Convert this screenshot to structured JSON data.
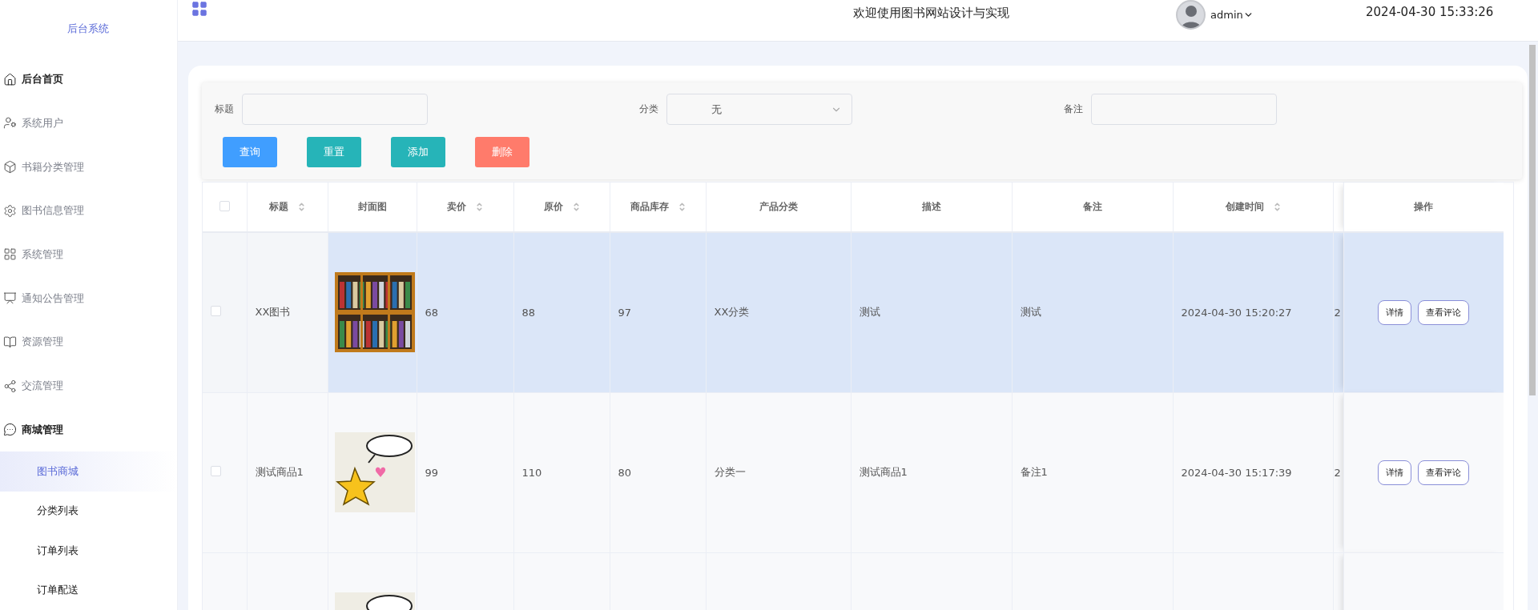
{
  "sidebar": {
    "title": "后台系统",
    "items": [
      {
        "label": "后台首页",
        "hovered": true,
        "expanded": false
      },
      {
        "label": "系统用户",
        "hovered": false,
        "expanded": false
      },
      {
        "label": "书籍分类管理",
        "hovered": false,
        "expanded": false
      },
      {
        "label": "图书信息管理",
        "hovered": false,
        "expanded": false
      },
      {
        "label": "系统管理",
        "hovered": false,
        "expanded": false
      },
      {
        "label": "通知公告管理",
        "hovered": false,
        "expanded": false
      },
      {
        "label": "资源管理",
        "hovered": false,
        "expanded": false
      },
      {
        "label": "交流管理",
        "hovered": false,
        "expanded": false
      },
      {
        "label": "商城管理",
        "hovered": false,
        "expanded": true,
        "children": [
          {
            "label": "图书商城",
            "selected": true
          },
          {
            "label": "分类列表",
            "selected": false
          },
          {
            "label": "订单列表",
            "selected": false
          },
          {
            "label": "订单配送",
            "selected": false
          }
        ]
      }
    ]
  },
  "header": {
    "title": "欢迎使用图书网站设计与实现",
    "user": "admin",
    "datetime": "2024-04-30 15:33:26"
  },
  "filters": [
    {
      "label": "标题",
      "kind": "input"
    },
    {
      "label": "分类",
      "kind": "select",
      "value": "无"
    },
    {
      "label": "备注",
      "kind": "input"
    }
  ],
  "buttons": [
    {
      "label": "查询",
      "kind": "primary"
    },
    {
      "label": "重置",
      "kind": "teal"
    },
    {
      "label": "添加",
      "kind": "teal"
    },
    {
      "label": "删除",
      "kind": "danger"
    }
  ],
  "table": {
    "all_checked": false,
    "columns": [
      {
        "label": "标题",
        "sortable": true
      },
      {
        "label": "封面图",
        "sortable": false
      },
      {
        "label": "卖价",
        "sortable": true
      },
      {
        "label": "原价",
        "sortable": true
      },
      {
        "label": "商品库存",
        "sortable": true
      },
      {
        "label": "产品分类",
        "sortable": false
      },
      {
        "label": "描述",
        "sortable": false
      },
      {
        "label": "备注",
        "sortable": false
      },
      {
        "label": "创建时间",
        "sortable": true
      }
    ],
    "action_column": "操作",
    "rows": [
      {
        "checked": false,
        "hovered": true,
        "cells": [
          "XX图书",
          "68",
          "88",
          "97",
          "XX分类",
          "测试",
          "测试",
          "2024-04-30 15:20:27"
        ],
        "column_11": "2",
        "actions": [
          "详情",
          "查看评论"
        ]
      },
      {
        "checked": false,
        "hovered": false,
        "cells": [
          "测试商品1",
          "99",
          "110",
          "80",
          "分类一",
          "测试商品1",
          "备注1",
          "2024-04-30 15:17:39"
        ],
        "column_11": "2",
        "actions": [
          "详情",
          "查看评论"
        ]
      },
      {
        "hovered": false
      }
    ]
  }
}
